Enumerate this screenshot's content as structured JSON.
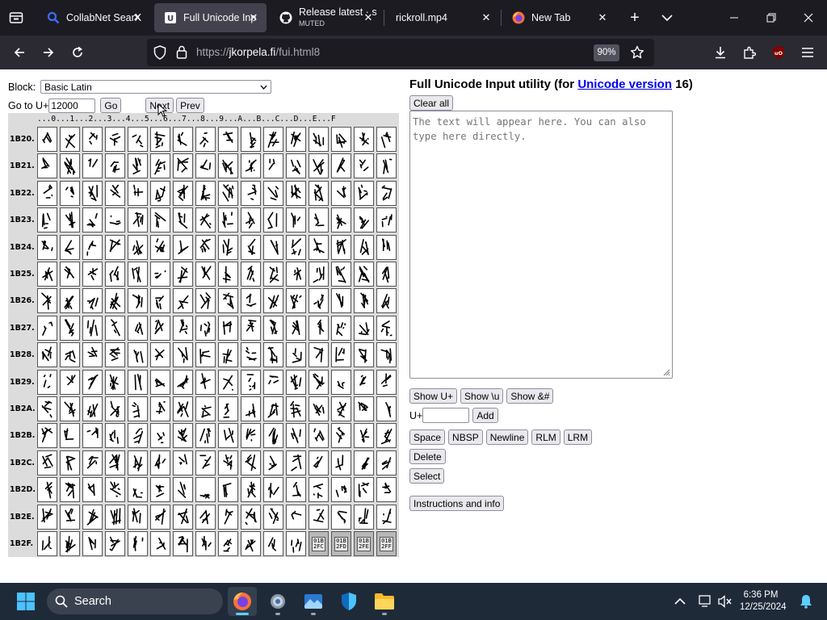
{
  "tabs": [
    {
      "title": "CollabNet SearX",
      "icon": "search-icon"
    },
    {
      "title": "Full Unicode Inp",
      "icon": "unicode-icon",
      "active": true
    },
    {
      "title": "Release latest · s",
      "subtitle": "MUTED",
      "icon": "github-icon"
    },
    {
      "title": "rickroll.mp4",
      "icon": ""
    },
    {
      "title": "New Tab",
      "icon": "firefox-icon"
    }
  ],
  "url": {
    "prefix": "https://",
    "host": "jkorpela.fi",
    "path": "/fui.html8"
  },
  "zoom": "90%",
  "block": {
    "label": "Block:",
    "selected": "Basic Latin"
  },
  "goto": {
    "label": "Go to U+",
    "value": "12000",
    "go": "Go",
    "next": "Next",
    "prev": "Prev"
  },
  "grid": {
    "column_header": "...0...1...2...3...4...5...6...7...8...9...A...B...C...D...E...F",
    "rows": [
      "1B20.",
      "1B21.",
      "1B22.",
      "1B23.",
      "1B24.",
      "1B25.",
      "1B26.",
      "1B27.",
      "1B28.",
      "1B29.",
      "1B2A.",
      "1B2B.",
      "1B2C.",
      "1B2D.",
      "1B2E.",
      "1B2F."
    ],
    "fallback_cells": [
      {
        "top": "01B",
        "bottom": "2FC"
      },
      {
        "top": "01B",
        "bottom": "2FD"
      },
      {
        "top": "01B",
        "bottom": "2FE"
      },
      {
        "top": "01B",
        "bottom": "2FF"
      }
    ]
  },
  "utility": {
    "title_pre": "Full Unicode Input utility (for ",
    "title_link": "Unicode version",
    "title_post": " 16)",
    "clear_all": "Clear all",
    "placeholder": "The text will appear here. You can also type here directly.",
    "show_u": "Show U+",
    "show_backslash": "Show \\u",
    "show_amp": "Show &#",
    "uplus_label": "U+",
    "add": "Add",
    "space": "Space",
    "nbsp": "NBSP",
    "newline": "Newline",
    "rlm": "RLM",
    "lrm": "LRM",
    "delete": "Delete",
    "select": "Select",
    "instructions": "Instructions and info"
  },
  "taskbar": {
    "search_placeholder": "Search",
    "time": "6:36 PM",
    "date": "12/25/2024"
  },
  "colors": {
    "accent": "#60cdff",
    "link": "#0000ee",
    "tab_active": "#42414d",
    "taskbar": "#1f2a39"
  }
}
